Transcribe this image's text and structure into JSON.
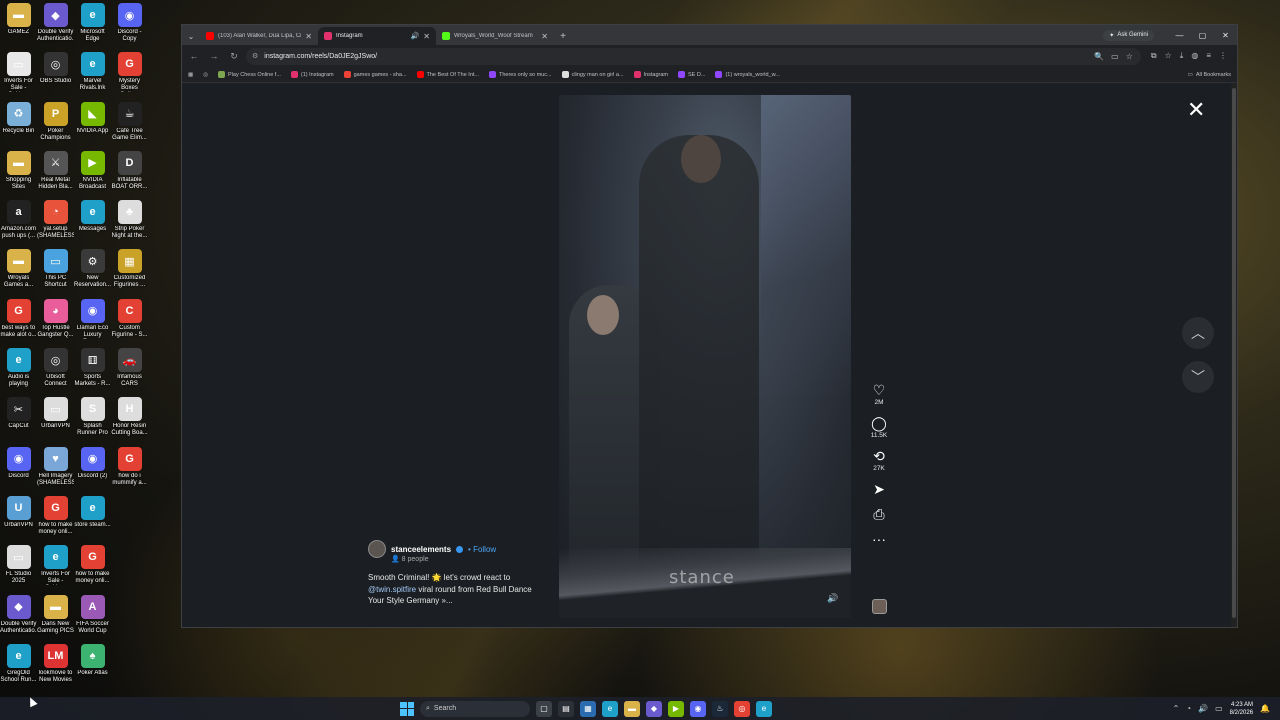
{
  "desktop": {
    "icons": [
      {
        "label": "GAMEZ",
        "color": "#d9b24a",
        "glyph": "▬"
      },
      {
        "label": "Double Verify Authenticatio...",
        "color": "#6a5acd",
        "glyph": "◆"
      },
      {
        "label": "Microsoft Edge",
        "color": "#1fa0c9",
        "glyph": "e"
      },
      {
        "label": "Discord - Copy",
        "color": "#5865f2",
        "glyph": "◉"
      },
      {
        "label": "Inverts For Sale - Spide...",
        "color": "#e8e8e8",
        "glyph": "▭"
      },
      {
        "label": "OBS Studio",
        "color": "#333",
        "glyph": "◎"
      },
      {
        "label": "Marvel Rivals.lnk",
        "color": "#1fa0c9",
        "glyph": "e"
      },
      {
        "label": "Mystery Boxes Onlin...",
        "color": "#e34133",
        "glyph": "G"
      },
      {
        "label": "Recycle Bin",
        "color": "#7ab0d8",
        "glyph": "♻"
      },
      {
        "label": "Poker Champions",
        "color": "#c9a227",
        "glyph": "P"
      },
      {
        "label": "NVIDIA App",
        "color": "#76b900",
        "glyph": "◣"
      },
      {
        "label": "Cafe Tree Game Elim...",
        "color": "#222",
        "glyph": "☕"
      },
      {
        "label": "Shopping Sites",
        "color": "#d9b24a",
        "glyph": "▬"
      },
      {
        "label": "Real Metal Hidden Bla...",
        "color": "#555",
        "glyph": "⚔"
      },
      {
        "label": "NVIDIA Broadcast",
        "color": "#76b900",
        "glyph": "▶"
      },
      {
        "label": "Inflatable BOAT ORR...",
        "color": "#444",
        "glyph": "D"
      },
      {
        "label": "Amazon.com push ups (...",
        "color": "#222",
        "glyph": "a"
      },
      {
        "label": "yal.setup (SHAMELESS)",
        "color": "#e8533b",
        "glyph": "◔"
      },
      {
        "label": "Messages",
        "color": "#1fa0c9",
        "glyph": "e"
      },
      {
        "label": "Strip Poker Night at the...",
        "color": "#ddd",
        "glyph": "♣"
      },
      {
        "label": "Wroyals Games a...",
        "color": "#d9b24a",
        "glyph": "▬"
      },
      {
        "label": "This PC Shortcut",
        "color": "#4aa3df",
        "glyph": "▭"
      },
      {
        "label": "New Reservation...",
        "color": "#3a3a3a",
        "glyph": "⚙"
      },
      {
        "label": "Customized Figurines ...",
        "color": "#c9a227",
        "glyph": "▦"
      },
      {
        "label": "best ways to make alot o...",
        "color": "#e34133",
        "glyph": "G"
      },
      {
        "label": "Top Hustle Gangster Q...",
        "color": "#e85d9a",
        "glyph": "◕"
      },
      {
        "label": "Llaman Eco Luxury Reso...",
        "color": "#5865f2",
        "glyph": "◉"
      },
      {
        "label": "Custom Figurine - S...",
        "color": "#e34133",
        "glyph": "C"
      },
      {
        "label": "Audio is playing",
        "color": "#1fa0c9",
        "glyph": "e"
      },
      {
        "label": "Ubisoft Connect",
        "color": "#333",
        "glyph": "◎"
      },
      {
        "label": "Sports Markets - R...",
        "color": "#333",
        "glyph": "⚅"
      },
      {
        "label": "Infamous CARS",
        "color": "#444",
        "glyph": "🚗"
      },
      {
        "label": "CapCut",
        "color": "#222",
        "glyph": "✂"
      },
      {
        "label": "UrbanVPN",
        "color": "#ddd",
        "glyph": "▭"
      },
      {
        "label": "Splash Runner Pro ...",
        "color": "#ddd",
        "glyph": "S"
      },
      {
        "label": "Honor Resin Cutting Boa...",
        "color": "#ddd",
        "glyph": "H"
      },
      {
        "label": "Discord",
        "color": "#5865f2",
        "glyph": "◉"
      },
      {
        "label": "Hell Imagery (SHAMELESS)",
        "color": "#7aa7d8",
        "glyph": "♥"
      },
      {
        "label": "Discord (2)",
        "color": "#5865f2",
        "glyph": "◉"
      },
      {
        "label": "how do i mummify a...",
        "color": "#e34133",
        "glyph": "G"
      },
      {
        "label": "UrbanVPN",
        "color": "#5a9fd4",
        "glyph": "U"
      },
      {
        "label": "how to make money onli...",
        "color": "#e34133",
        "glyph": "G"
      },
      {
        "label": "store steam...",
        "color": "#1fa0c9",
        "glyph": "e"
      },
      {
        "label": "",
        "color": "transparent",
        "glyph": ""
      },
      {
        "label": "FL Studio 2025",
        "color": "#ddd",
        "glyph": "▭"
      },
      {
        "label": "Inverts For Sale - Spide...",
        "color": "#1fa0c9",
        "glyph": "e"
      },
      {
        "label": "how to make money onli...",
        "color": "#e34133",
        "glyph": "G"
      },
      {
        "label": "",
        "color": "transparent",
        "glyph": ""
      },
      {
        "label": "Double Verify Authenticatio...",
        "color": "#6a5acd",
        "glyph": "◆"
      },
      {
        "label": "Dans New Gaming PICS",
        "color": "#d9b24a",
        "glyph": "▬"
      },
      {
        "label": "FIFA Soccer World Cup",
        "color": "#9b59b6",
        "glyph": "A"
      },
      {
        "label": "",
        "color": "transparent",
        "glyph": ""
      },
      {
        "label": "GregOld School Run...",
        "color": "#1fa0c9",
        "glyph": "e"
      },
      {
        "label": "lookmovie to New Movies",
        "color": "#d33",
        "glyph": "LM"
      },
      {
        "label": "Poker Atlas",
        "color": "#3cb371",
        "glyph": "♠"
      },
      {
        "label": "",
        "color": "transparent",
        "glyph": ""
      }
    ]
  },
  "browser": {
    "tabs": [
      {
        "title": "(103) Alan Walker, Dua Lipa, Cr",
        "favicon_color": "#ff0000",
        "active": false,
        "audio": false
      },
      {
        "title": "Instagram",
        "favicon_color": "#e1306c",
        "active": true,
        "audio": true
      },
      {
        "title": "Wroyals_World_Woof Stream",
        "favicon_color": "#53fc18",
        "active": false,
        "audio": false
      }
    ],
    "gemini_label": "Ask Gemini",
    "url": "instagram.com/reels/Da0JE2gJSwo/",
    "bookmarks": [
      {
        "label": "Play Chess Online f...",
        "color": "#7fa650"
      },
      {
        "label": "(1) Instagram",
        "color": "#e1306c"
      },
      {
        "label": "games games - sha...",
        "color": "#ea4335"
      },
      {
        "label": "The Best Of The Int...",
        "color": "#ff0000"
      },
      {
        "label": "Theres only so muc...",
        "color": "#9147ff"
      },
      {
        "label": "clingy man on girl a...",
        "color": "#ddd"
      },
      {
        "label": "Instagram",
        "color": "#e1306c"
      },
      {
        "label": "SE D...",
        "color": "#9147ff"
      },
      {
        "label": "(1) wroyals_world_w...",
        "color": "#9147ff"
      }
    ],
    "all_bookmarks_label": "All Bookmarks"
  },
  "reel": {
    "watermark": "stance",
    "author": "stanceelements",
    "follow_label": "Follow",
    "people": "8 people",
    "caption_part1": "Smooth Criminal! 🌟 let's crowd react to",
    "mention": "@twin.spitfire",
    "caption_part2": " viral round from Red Bull Dance Your Style Germany »...",
    "likes": "2M",
    "comments": "11.5K",
    "reposts": "27K"
  },
  "taskbar": {
    "search_placeholder": "Search",
    "time": "4:23 AM",
    "date": "8/2/2026"
  }
}
